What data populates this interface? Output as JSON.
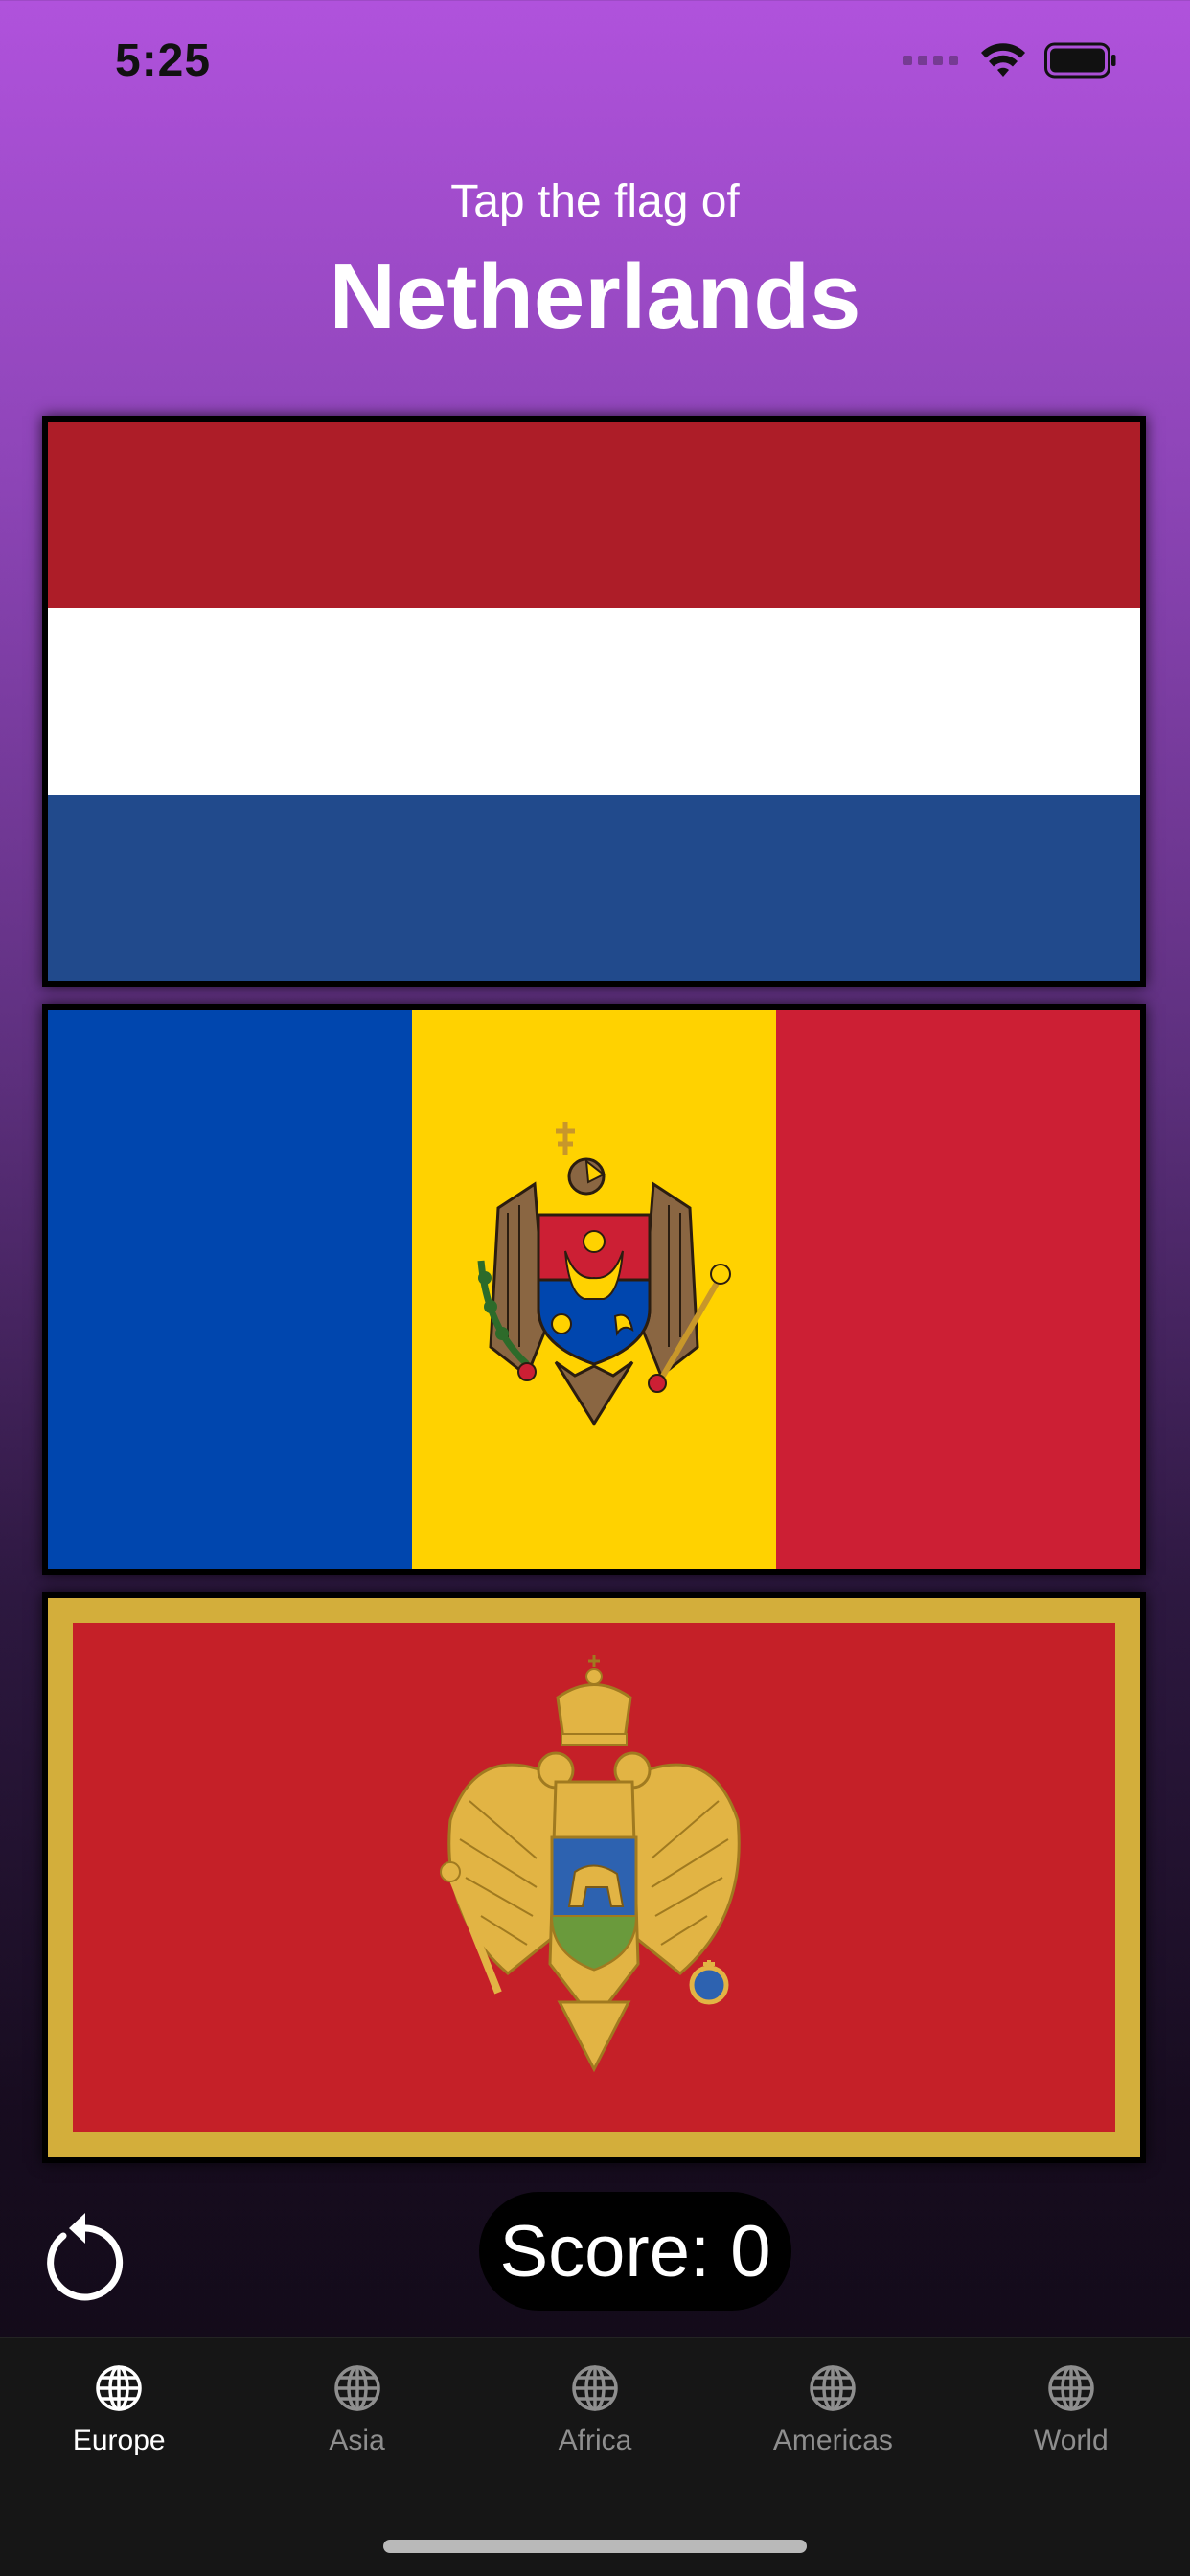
{
  "status_bar": {
    "time": "5:25",
    "icons": [
      "cellular-signal-icon",
      "wifi-icon",
      "battery-icon"
    ]
  },
  "header": {
    "subtitle": "Tap the flag of",
    "country": "Netherlands"
  },
  "flags": [
    {
      "name": "netherlands-flag",
      "colors": [
        "#ad1d28",
        "#ffffff",
        "#214a8c"
      ]
    },
    {
      "name": "moldova-flag",
      "colors": [
        "#0046ae",
        "#ffd200",
        "#cc1f34"
      ]
    },
    {
      "name": "montenegro-flag",
      "colors": [
        "#d3ae3b",
        "#c52028"
      ]
    }
  ],
  "score": {
    "label": "Score: 0"
  },
  "restart": {
    "icon": "restart-icon"
  },
  "tabs": [
    {
      "label": "Europe",
      "icon": "globe-icon",
      "active": true
    },
    {
      "label": "Asia",
      "icon": "globe-icon",
      "active": false
    },
    {
      "label": "Africa",
      "icon": "globe-icon",
      "active": false
    },
    {
      "label": "Americas",
      "icon": "globe-icon",
      "active": false
    },
    {
      "label": "World",
      "icon": "globe-icon",
      "active": false
    }
  ]
}
